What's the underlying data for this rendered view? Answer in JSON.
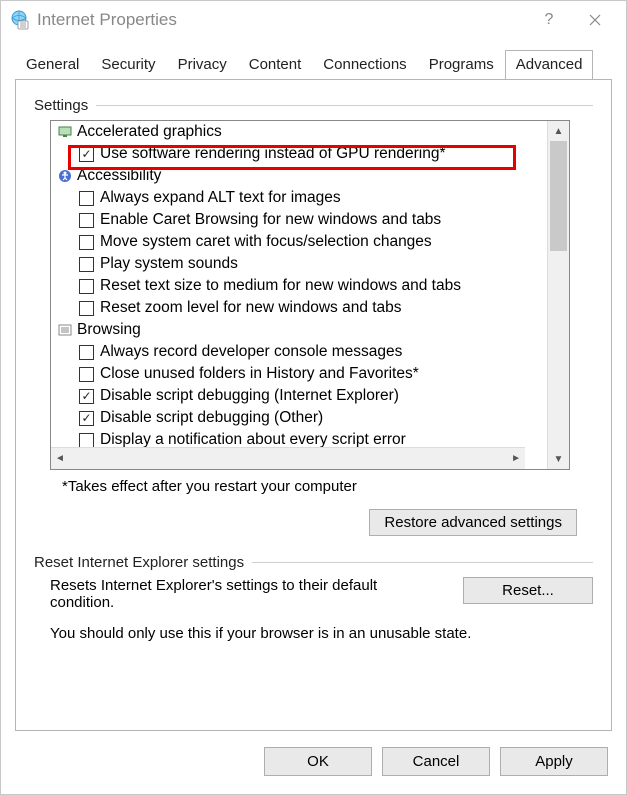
{
  "window": {
    "title": "Internet Properties"
  },
  "tabs": [
    "General",
    "Security",
    "Privacy",
    "Content",
    "Connections",
    "Programs",
    "Advanced"
  ],
  "activeTabIndex": 6,
  "settings": {
    "groupLabel": "Settings",
    "tree": [
      {
        "type": "category",
        "icon": "monitor",
        "label": "Accelerated graphics"
      },
      {
        "type": "check",
        "checked": true,
        "label": "Use software rendering instead of GPU rendering*",
        "highlight": true
      },
      {
        "type": "category",
        "icon": "access",
        "label": "Accessibility"
      },
      {
        "type": "check",
        "checked": false,
        "label": "Always expand ALT text for images"
      },
      {
        "type": "check",
        "checked": false,
        "label": "Enable Caret Browsing for new windows and tabs"
      },
      {
        "type": "check",
        "checked": false,
        "label": "Move system caret with focus/selection changes"
      },
      {
        "type": "check",
        "checked": false,
        "label": "Play system sounds"
      },
      {
        "type": "check",
        "checked": false,
        "label": "Reset text size to medium for new windows and tabs"
      },
      {
        "type": "check",
        "checked": false,
        "label": "Reset zoom level for new windows and tabs"
      },
      {
        "type": "category",
        "icon": "doc",
        "label": "Browsing"
      },
      {
        "type": "check",
        "checked": false,
        "label": "Always record developer console messages"
      },
      {
        "type": "check",
        "checked": false,
        "label": "Close unused folders in History and Favorites*"
      },
      {
        "type": "check",
        "checked": true,
        "label": "Disable script debugging (Internet Explorer)"
      },
      {
        "type": "check",
        "checked": true,
        "label": "Disable script debugging (Other)"
      },
      {
        "type": "check",
        "checked": false,
        "label": "Display a notification about every script error"
      }
    ],
    "note": "*Takes effect after you restart your computer",
    "restoreBtn": "Restore advanced settings"
  },
  "reset": {
    "groupLabel": "Reset Internet Explorer settings",
    "desc": "Resets Internet Explorer's settings to their default condition.",
    "btn": "Reset...",
    "warn": "You should only use this if your browser is in an unusable state."
  },
  "footer": {
    "ok": "OK",
    "cancel": "Cancel",
    "apply": "Apply"
  }
}
